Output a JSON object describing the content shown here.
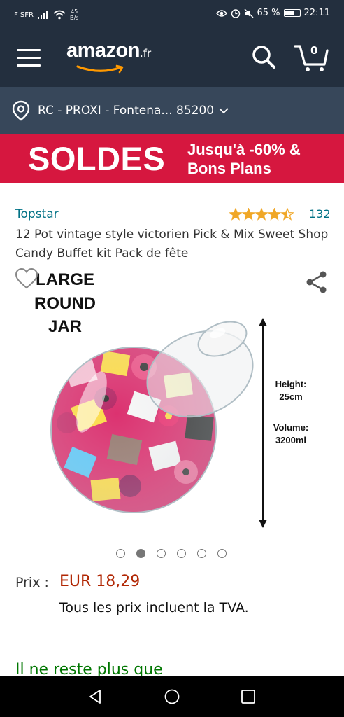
{
  "status_bar": {
    "carrier": "F SFR",
    "speed_value": "45",
    "speed_unit": "B/s",
    "battery": "65 %",
    "battery_level": 0.65,
    "time": "22:11"
  },
  "header": {
    "logo_text": "amazon",
    "logo_tld": ".fr",
    "cart_count": "0",
    "icons": [
      "menu-icon",
      "search-icon",
      "cart-icon"
    ]
  },
  "delivery": {
    "location": "RC - PROXI - Fontena... 85200"
  },
  "banner": {
    "headline": "SOLDES",
    "line1": "Jusqu'à -60% &",
    "line2": "Bons Plans",
    "color": "#d6173f"
  },
  "product": {
    "brand": "Topstar",
    "rating_stars": 4.5,
    "rating_count": "132",
    "title": "12 Pot vintage style victorien Pick & Mix Sweet Shop Candy Buffet kit Pack de fête",
    "image_text": {
      "headline_lines": [
        "LARGE",
        "ROUND",
        "JAR"
      ],
      "height_label": "Height:",
      "height_value": "25cm",
      "volume_label": "Volume:",
      "volume_value": "3200ml"
    },
    "image_count": 6,
    "active_image_index": 1,
    "price_label": "Prix :",
    "price": "EUR 18,29",
    "tax_note": "Tous les prix incluent la TVA.",
    "stock_note": "Il ne reste plus que"
  },
  "colors": {
    "header_bg": "#232f3e",
    "delivery_bg": "#37475a",
    "link": "#007185",
    "price": "#b12704",
    "star": "#f0a727",
    "stock": "#007600"
  }
}
